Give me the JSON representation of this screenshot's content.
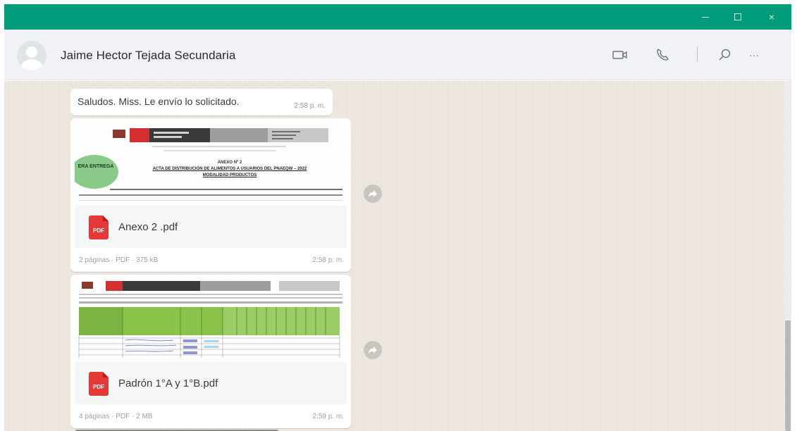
{
  "window": {
    "accent_color": "#009c7a",
    "controls": {
      "minimize_icon": "minimize-icon",
      "maximize_icon": "maximize-icon",
      "close_label": "×"
    }
  },
  "chat_header": {
    "contact_name": "Jaime Hector Tejada Secundaria",
    "icons": [
      "video-call-icon",
      "voice-call-icon",
      "search-icon",
      "more-options-icon"
    ],
    "more_label": "···"
  },
  "messages": [
    {
      "type": "text",
      "text": "Saludos. Miss. Le envío lo solicitado.",
      "time": "2:58 p. m."
    },
    {
      "type": "document",
      "file_name": "Anexo 2 .pdf",
      "file_type_badge": "PDF",
      "meta": "2 páginas · PDF · 375 kB",
      "time": "2:58 p. m.",
      "preview": {
        "stamp": "ERA ENTREGA",
        "title_line_1": "ANEXO Nº 2",
        "title_line_2": "ACTA DE DISTRIBUCIÓN DE ALIMENTOS A USUARIOS DEL PNAEQW – 2022",
        "title_line_3": "MODALIDAD PRODUCTOS"
      }
    },
    {
      "type": "document",
      "file_name": "Padrón 1°A y 1°B.pdf",
      "file_type_badge": "PDF",
      "meta": "4 páginas · PDF · 2 MB",
      "time": "2:59 p. m."
    }
  ]
}
